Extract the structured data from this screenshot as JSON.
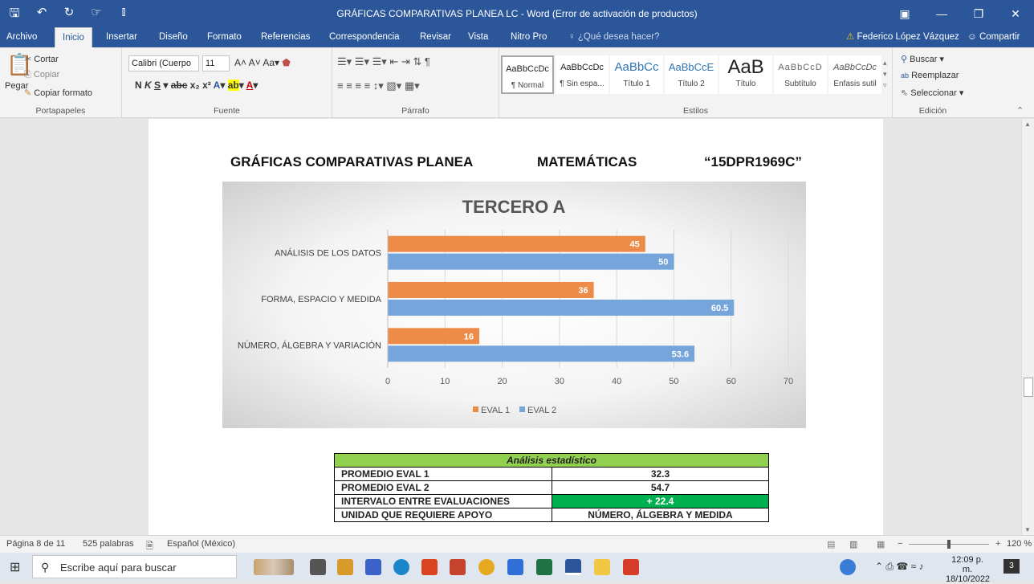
{
  "window": {
    "title": "GRÁFICAS COMPARATIVAS PLANEA  LC - Word (Error de activación de productos)"
  },
  "tabs": [
    "Archivo",
    "Inicio",
    "Insertar",
    "Diseño",
    "Formato",
    "Referencias",
    "Correspondencia",
    "Revisar",
    "Vista",
    "Nitro Pro"
  ],
  "tell_me": "¿Qué desea hacer?",
  "user_name": "Federico López Vázquez",
  "share_label": "Compartir",
  "ribbon": {
    "clipboard": {
      "paste": "Pegar",
      "cut": "Cortar",
      "copy": "Copiar",
      "format_painter": "Copiar formato",
      "label": "Portapapeles"
    },
    "font": {
      "family": "Calibri (Cuerpo",
      "size": "11",
      "label": "Fuente"
    },
    "paragraph": {
      "label": "Párrafo"
    },
    "styles": {
      "label": "Estilos",
      "items": [
        {
          "preview": "AaBbCcDc",
          "name": "¶ Normal"
        },
        {
          "preview": "AaBbCcDc",
          "name": "¶ Sin espa..."
        },
        {
          "preview": "AaBbCc",
          "name": "Título 1"
        },
        {
          "preview": "AaBbCcE",
          "name": "Título 2"
        },
        {
          "preview": "AaB",
          "name": "Título"
        },
        {
          "preview": "AaBbCcD",
          "name": "Subtítulo"
        },
        {
          "preview": "AaBbCcDc",
          "name": "Énfasis sutil"
        }
      ]
    },
    "editing": {
      "find": "Buscar",
      "replace": "Reemplazar",
      "select": "Seleccionar",
      "label": "Edición"
    }
  },
  "document": {
    "heading_left": "GRÁFICAS COMPARATIVAS PLANEA",
    "heading_mid": "MATEMÁTICAS",
    "heading_right": "“15DPR1969C”",
    "stats": {
      "title": "Análisis estadístico",
      "rows": [
        {
          "label": "PROMEDIO EVAL 1",
          "value": "32.3"
        },
        {
          "label": "PROMEDIO EVAL 2",
          "value": "54.7"
        },
        {
          "label": "INTERVALO ENTRE EVALUACIONES",
          "value": "+ 22.4"
        },
        {
          "label": "UNIDAD QUE REQUIERE APOYO",
          "value": "NÚMERO, ÁLGEBRA Y MEDIDA"
        }
      ]
    }
  },
  "chart_data": {
    "type": "bar",
    "orientation": "horizontal",
    "title": "TERCERO A",
    "categories": [
      "ANÁLISIS DE LOS DATOS",
      "FORMA, ESPACIO Y MEDIDA",
      "NÚMERO, ÁLGEBRA Y VARIACIÓN"
    ],
    "series": [
      {
        "name": "EVAL 1",
        "values": [
          45,
          36,
          16
        ],
        "color": "#ed8b48"
      },
      {
        "name": "EVAL 2",
        "values": [
          50,
          60.5,
          53.6
        ],
        "color": "#75a5da"
      }
    ],
    "xlim": [
      0,
      70
    ],
    "ticks": [
      0,
      10,
      20,
      30,
      40,
      50,
      60,
      70
    ],
    "grid": true,
    "legend": "bottom"
  },
  "status": {
    "page": "Página 8 de 11",
    "words": "525 palabras",
    "language": "Español (México)",
    "zoom": "120 %"
  },
  "taskbar": {
    "search_placeholder": "Escribe aquí para buscar",
    "time": "12:09 p. m.",
    "date": "18/10/2022",
    "notifications": "3"
  }
}
